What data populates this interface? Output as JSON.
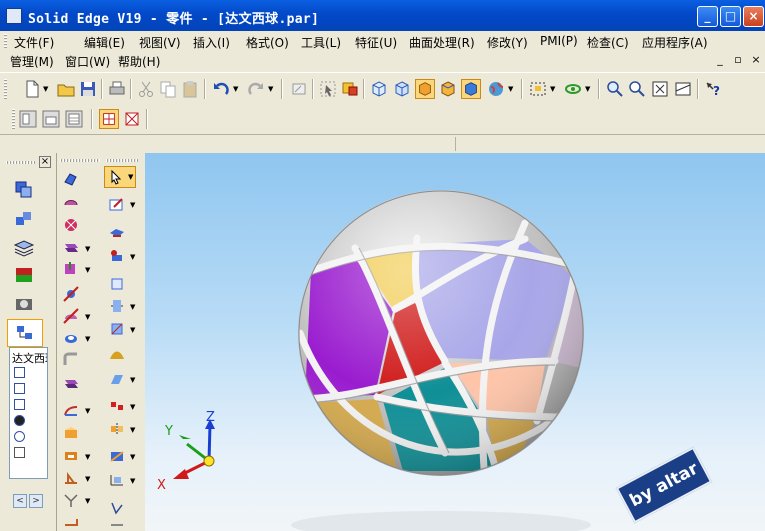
{
  "window": {
    "title": "Solid Edge V19 - 零件 - [达文西球.par]",
    "minimize_glyph": "_",
    "maximize_glyph": "□",
    "close_glyph": "×"
  },
  "menu": {
    "row1": [
      "文件(F)",
      "编辑(E)",
      "视图(V)",
      "插入(I)",
      "格式(O)",
      "工具(L)",
      "特征(U)",
      "曲面处理(R)",
      "修改(Y)",
      "PMI(P)",
      "检查(C)",
      "应用程序(A)"
    ],
    "row2": [
      "管理(M)",
      "窗口(W)",
      "帮助(H)"
    ],
    "mdi_minimize": "_",
    "mdi_restore": "▫",
    "mdi_close": "×"
  },
  "pane": {
    "close_glyph": "×",
    "tree_root": "达文西球",
    "scroll_left": "<",
    "scroll_right": ">"
  },
  "viewport": {
    "watermark": "by altar",
    "axis_x": "X",
    "axis_y": "Y",
    "axis_z": "Z"
  },
  "colors": {
    "title_bar": "#0249c9",
    "chrome": "#ece9d8",
    "viewport_top": "#8fc6f0",
    "viewport_bottom": "#f1f5f8",
    "patch_purple": "#9a1ccf",
    "patch_yellow": "#f1cd55",
    "patch_red": "#d01a1a",
    "patch_teal": "#0f8f96",
    "patch_lavender": "#a8a6e8",
    "patch_peach": "#ffc4a8",
    "patch_mauve": "#c8b6cc",
    "patch_gold": "#d4a94c"
  },
  "icons": {
    "toolbar_row1": [
      "new-file-icon",
      "open-folder-icon",
      "save-icon",
      "print-icon",
      "cut-icon",
      "copy-icon",
      "paste-icon",
      "undo-icon",
      "redo-icon",
      "sketch-icon",
      "select-icon",
      "display-icon",
      "view-cube-icon",
      "shaded-icon",
      "render-icon",
      "globe-icon",
      "fit-icon",
      "rotate-icon",
      "zoom-area-icon",
      "zoom-icon",
      "zoom-all-icon",
      "window-icon",
      "help-icon"
    ],
    "toolbar_row2": [
      "view-left-icon",
      "view-right-icon",
      "view-3d-icon",
      "select-edges-icon",
      "select-faces-icon"
    ]
  }
}
